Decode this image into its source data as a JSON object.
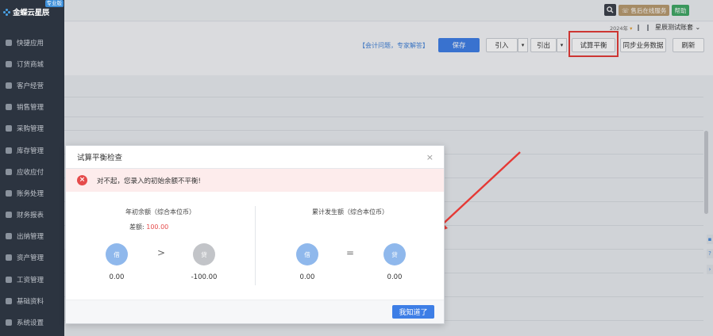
{
  "app": {
    "logo_text": "金蝶云星辰",
    "logo_badge": "专业版"
  },
  "sidebar": {
    "items": [
      {
        "label": "快捷应用",
        "icon": "grid-icon"
      },
      {
        "label": "订货商城",
        "icon": "shop-icon"
      },
      {
        "label": "客户经营",
        "icon": "customer-icon"
      },
      {
        "label": "销售管理",
        "icon": "sales-icon"
      },
      {
        "label": "采购管理",
        "icon": "purchase-icon"
      },
      {
        "label": "库存管理",
        "icon": "inventory-icon"
      },
      {
        "label": "应收应付",
        "icon": "receivable-icon"
      },
      {
        "label": "账务处理",
        "icon": "ledger-icon"
      },
      {
        "label": "财务报表",
        "icon": "report-icon"
      },
      {
        "label": "出纳管理",
        "icon": "cashier-icon"
      },
      {
        "label": "资产管理",
        "icon": "asset-icon"
      },
      {
        "label": "工资管理",
        "icon": "salary-icon"
      },
      {
        "label": "基础资料",
        "icon": "base-data-icon"
      },
      {
        "label": "系统设置",
        "icon": "gear-icon"
      }
    ]
  },
  "topbar": {
    "service_label": "售后在线服务",
    "help_label": "帮助"
  },
  "toolbar": {
    "year": "2024年",
    "account_set": "星辰测试账套",
    "qa_link": "【会计问题，专家解答】",
    "save": "保存",
    "import": "引入",
    "export": "引出",
    "trial_balance": "试算平衡",
    "sync": "同步业务数据",
    "refresh": "刷新"
  },
  "modal": {
    "title": "试算平衡检查",
    "alert": "对不起，您录入的初始余额不平衡!",
    "left": {
      "title": "年初余额（综合本位币）",
      "diff_label": "差额:",
      "diff_value": "100.00",
      "debit_label": "借",
      "credit_label": "贷",
      "operator": ">",
      "debit_amount": "0.00",
      "credit_amount": "-100.00"
    },
    "right": {
      "title": "累计发生额（综合本位币）",
      "debit_label": "借",
      "credit_label": "贷",
      "operator": "=",
      "debit_amount": "0.00",
      "credit_amount": "0.00"
    },
    "ok_button": "我知道了"
  },
  "colors": {
    "accent": "#3d7ee6",
    "error": "#e54b4b",
    "highlight": "#e53935"
  }
}
